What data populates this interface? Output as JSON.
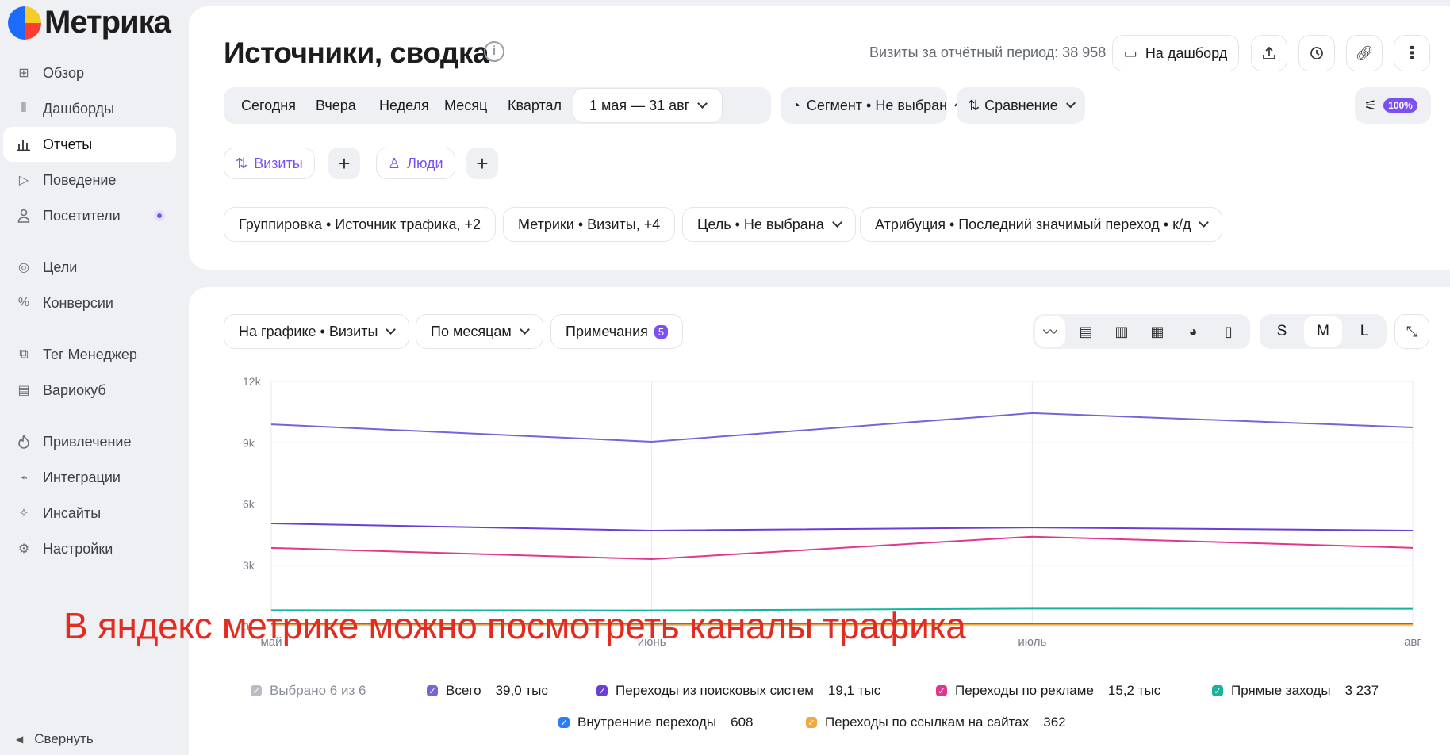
{
  "app": {
    "name": "Метрика"
  },
  "sidebar": {
    "items": [
      {
        "label": "Обзор",
        "icon": "grid-icon"
      },
      {
        "label": "Дашборды",
        "icon": "dashboard-icon"
      },
      {
        "label": "Отчеты",
        "icon": "bar-chart-icon",
        "active": true
      },
      {
        "label": "Поведение",
        "icon": "play-icon"
      },
      {
        "label": "Посетители",
        "icon": "user-icon"
      },
      {
        "label": "Цели",
        "icon": "target-icon"
      },
      {
        "label": "Конверсии",
        "icon": "percent-icon"
      },
      {
        "label": "Тег Менеджер",
        "icon": "tag-icon"
      },
      {
        "label": "Вариокуб",
        "icon": "cube-icon"
      },
      {
        "label": "Привлечение",
        "icon": "flame-icon"
      },
      {
        "label": "Интеграции",
        "icon": "plug-icon"
      },
      {
        "label": "Инсайты",
        "icon": "sparkle-icon"
      },
      {
        "label": "Настройки",
        "icon": "gear-icon"
      }
    ],
    "collapse_label": "Свернуть"
  },
  "header": {
    "title": "Источники, сводка",
    "visits_total": "Визиты за отчётный период: 38 958",
    "dashboard_button": "На дашборд"
  },
  "periods": {
    "items": [
      "Сегодня",
      "Вчера",
      "Неделя",
      "Месяц",
      "Квартал"
    ],
    "date_range": "1 мая — 31 авг",
    "segment": "Сегмент • Не выбран",
    "comparison": "Сравнение",
    "sampling": "100%"
  },
  "metrics_chips": {
    "visits": "Визиты",
    "people": "Люди"
  },
  "filters": {
    "grouping": "Группировка • Источник трафика, +2",
    "metrics": "Метрики • Визиты, +4",
    "goal": "Цель • Не выбрана",
    "attribution": "Атрибуция • Последний значимый переход • к/д"
  },
  "chart_controls": {
    "on_chart": "На графике • Визиты",
    "by_period": "По месяцам",
    "notes": "Примечания",
    "notes_count": "5",
    "sizes": [
      "S",
      "M",
      "L"
    ],
    "active_size": "M"
  },
  "chart_data": {
    "type": "line",
    "categories": [
      "май",
      "июнь",
      "июль",
      "авг"
    ],
    "yticks": [
      "12k",
      "9k",
      "6k",
      "3k",
      "0"
    ],
    "ylim": [
      0,
      12000
    ],
    "grid": true,
    "series": [
      {
        "name": "Всего",
        "color": "#7a63d8",
        "values": [
          9900,
          9050,
          10450,
          9750
        ]
      },
      {
        "name": "Переходы из поисковых систем",
        "color": "#6a3fd6",
        "values": [
          5050,
          4700,
          4850,
          4700
        ]
      },
      {
        "name": "Переходы по рекламе",
        "color": "#e0388e",
        "values": [
          3850,
          3300,
          4400,
          3850
        ]
      },
      {
        "name": "Прямые заходы",
        "color": "#18b39a",
        "values": [
          800,
          790,
          880,
          870
        ]
      },
      {
        "name": "Внутренние переходы",
        "color": "#2e7cf6",
        "values": [
          150,
          150,
          155,
          153
        ]
      },
      {
        "name": "Переходы по ссылкам на сайтах",
        "color": "#f2a93b",
        "values": [
          90,
          88,
          92,
          92
        ]
      }
    ]
  },
  "legend": {
    "selected": "Выбрано 6 из 6",
    "items": [
      {
        "label": "Всего",
        "value": "39,0 тыс",
        "color": "#7a63d8"
      },
      {
        "label": "Переходы из поисковых систем",
        "value": "19,1 тыс",
        "color": "#6a3fd6"
      },
      {
        "label": "Переходы по рекламе",
        "value": "15,2 тыс",
        "color": "#e0388e"
      },
      {
        "label": "Прямые заходы",
        "value": "3 237",
        "color": "#18b39a"
      },
      {
        "label": "Внутренние переходы",
        "value": "608",
        "color": "#2e7cf6"
      },
      {
        "label": "Переходы по ссылкам на сайтах",
        "value": "362",
        "color": "#f2a93b"
      }
    ]
  },
  "overlay_caption": "В яндекс метрике можно посмотреть каналы трафика"
}
